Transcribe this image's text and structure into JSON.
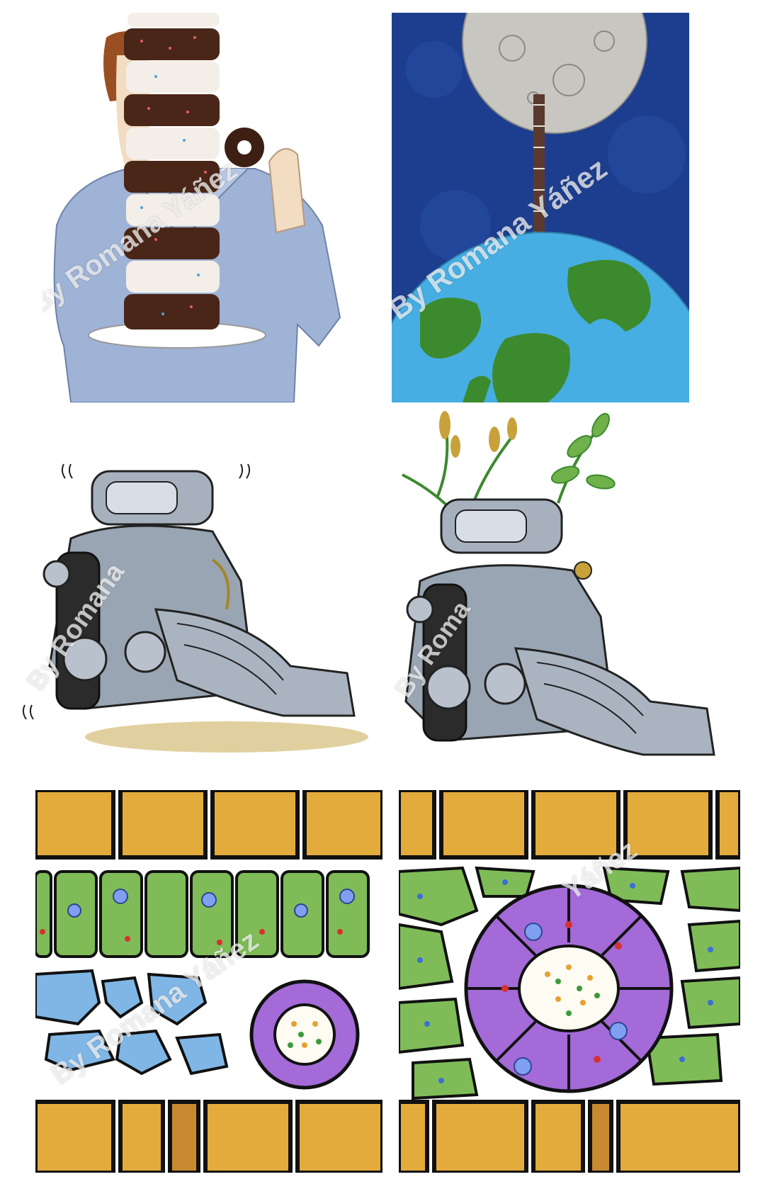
{
  "watermark": "By Romana Yáñez",
  "panels": [
    {
      "id": "donut-tower",
      "watermark": "By Romana Yáñez"
    },
    {
      "id": "moon-earth",
      "watermark": "By Romana Yáñez"
    },
    {
      "id": "engine-leaking",
      "watermark": "By Romana"
    },
    {
      "id": "engine-plants",
      "watermark": "By Roma"
    },
    {
      "id": "tissue-left",
      "watermark": "By Romana Yáñez"
    },
    {
      "id": "tissue-right",
      "watermark": "Yáñez"
    }
  ],
  "colors": {
    "space": "#1d3e8f",
    "moon": "#c8c6c1",
    "ocean": "#47aee3",
    "land": "#3c8a2e",
    "brick": "#e3ab3c",
    "green_cell": "#7fbc58",
    "purple": "#a36ad8",
    "blue_cell": "#7fb6e6",
    "metal": "#a7b1be",
    "chocolate": "#4a2618",
    "shirt": "#8fa8cf"
  }
}
